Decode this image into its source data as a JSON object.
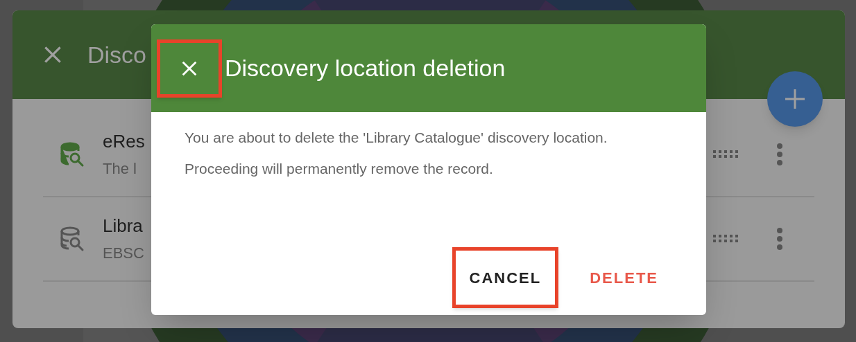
{
  "background_panel": {
    "title": "Disco",
    "rows": [
      {
        "title": "eRes",
        "subtitle": "The l",
        "active": true
      },
      {
        "title": "Libra",
        "subtitle": "EBSC",
        "active": false
      }
    ]
  },
  "dialog": {
    "title": "Discovery location deletion",
    "close_highlighted": true,
    "message": "You are about to delete the 'Library Catalogue' discovery location. Proceeding will permanently remove the record.",
    "buttons": [
      {
        "label": "CANCEL",
        "kind": "neutral",
        "highlighted": true
      },
      {
        "label": "DELETE",
        "kind": "danger",
        "highlighted": false
      }
    ]
  }
}
